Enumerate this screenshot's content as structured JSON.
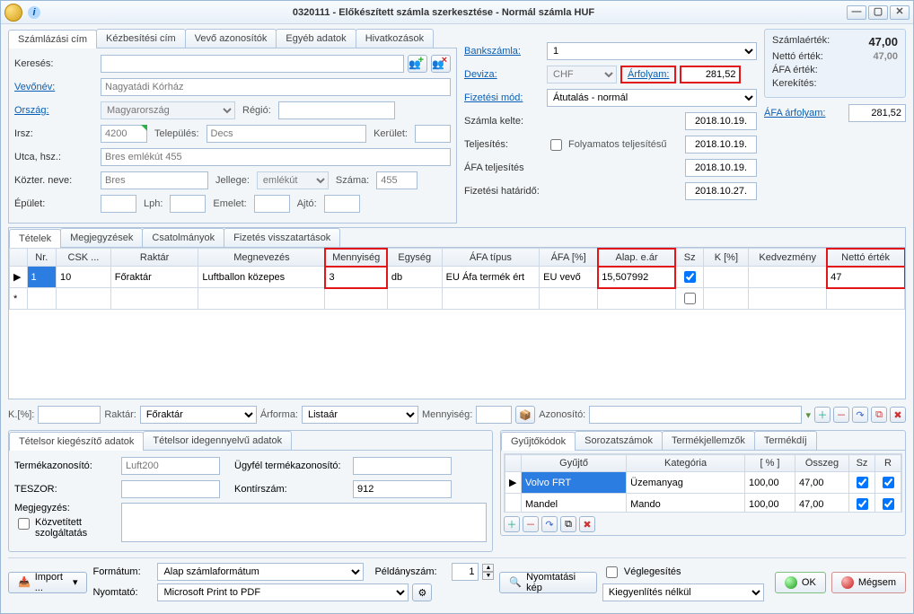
{
  "window": {
    "title": "0320111 - Előkészített számla szerkesztése - Normál számla HUF"
  },
  "addr_tabs": [
    "Számlázási cím",
    "Kézbesítési cím",
    "Vevő azonosítók",
    "Egyéb adatok",
    "Hivatkozások"
  ],
  "addr": {
    "search_lbl": "Keresés:",
    "vevonev_lbl": "Vevőnév:",
    "vevonev": "Nagyatádi Kórház",
    "orszag_lbl": "Ország:",
    "orszag": "Magyarország",
    "regio_lbl": "Régió:",
    "irsz_lbl": "Irsz:",
    "irsz": "4200",
    "telepules_lbl": "Település:",
    "telepules": "Decs",
    "kerulet_lbl": "Kerület:",
    "utca_lbl": "Utca, hsz.:",
    "utca": "Bres emlékút 455",
    "kozter_lbl": "Közter. neve:",
    "kozter": "Bres",
    "jellege_lbl": "Jellege:",
    "jellege": "emlékút",
    "szama_lbl": "Száma:",
    "szama": "455",
    "epulet_lbl": "Épület:",
    "lph_lbl": "Lph:",
    "emelet_lbl": "Emelet:",
    "ajto_lbl": "Ajtó:"
  },
  "mid": {
    "bankszamla_lbl": "Bankszámla:",
    "bankszamla": "1",
    "deviza_lbl": "Deviza:",
    "deviza": "CHF",
    "arfolyam_lbl": "Árfolyam:",
    "arfolyam": "281,52",
    "fizmod_lbl": "Fizetési mód:",
    "fizmod": "Átutalás - normál",
    "kelte_lbl": "Számla kelte:",
    "kelte": "2018.10.19.",
    "teljesites_lbl": "Teljesítés:",
    "folyamatos_lbl": "Folyamatos teljesítésű",
    "teljesites": "2018.10.19.",
    "afatelj_lbl": "ÁFA teljesítés",
    "afatelj": "2018.10.19.",
    "fizhat_lbl": "Fizetési határidő:",
    "fizhat": "2018.10.27."
  },
  "sums": {
    "szamlaertek_lbl": "Számlaérték:",
    "szamlaertek": "47,00",
    "netto_lbl": "Nettó érték:",
    "netto": "47,00",
    "afa_lbl": "ÁFA érték:",
    "kerekites_lbl": "Kerekítés:",
    "afa_arfolyam_lbl": "ÁFA árfolyam:",
    "afa_arfolyam": "281,52"
  },
  "items_tabs": [
    "Tételek",
    "Megjegyzések",
    "Csatolmányok",
    "Fizetés visszatartások"
  ],
  "items_cols": [
    "Nr.",
    "CSK ...",
    "Raktár",
    "Megnevezés",
    "Mennyiség",
    "Egység",
    "ÁFA típus",
    "ÁFA [%]",
    "Alap. e.ár",
    "Sz",
    "K [%]",
    "Kedvezmény",
    "Nettó érték"
  ],
  "items_rows": [
    {
      "nr": "1",
      "csk": "10",
      "raktar": "Főraktár",
      "megn": "Luftballon közepes",
      "menny": "3",
      "egys": "db",
      "afat": "EU Áfa termék ért",
      "afap": "EU vevő",
      "alap": "15,507992",
      "sz": true,
      "kpct": "",
      "kedv": "",
      "netto": "47"
    }
  ],
  "filter": {
    "kpct_lbl": "K.[%]:",
    "raktar_lbl": "Raktár:",
    "raktar": "Főraktár",
    "arforma_lbl": "Árforma:",
    "arforma": "Listaár",
    "mennyiseg_lbl": "Mennyiség:",
    "azonosito_lbl": "Azonosító:"
  },
  "detail_tabs_left": [
    "Tételsor kiegészítő adatok",
    "Tételsor idegennyelvű adatok"
  ],
  "detail_left": {
    "termekazon_lbl": "Termékazonosító:",
    "termekazon": "Luft200",
    "ugyfelterm_lbl": "Ügyfél termékazonosító:",
    "teszor_lbl": "TESZOR:",
    "kontir_lbl": "Kontírszám:",
    "kontir": "912",
    "megjegyzes_lbl": "Megjegyzés:",
    "kozvetitett_lbl": "Közvetített szolgáltatás"
  },
  "detail_tabs_right": [
    "Gyűjtőkódok",
    "Sorozatszámok",
    "Termékjellemzők",
    "Termékdíj"
  ],
  "gyujto_cols": [
    "Gyűjtő",
    "Kategória",
    "[ % ]",
    "Összeg",
    "Sz",
    "R"
  ],
  "gyujto_rows": [
    {
      "gy": "Volvo FRT",
      "kat": "Üzemanyag",
      "pct": "100,00",
      "ossz": "47,00",
      "sz": true,
      "r": true
    },
    {
      "gy": "Mandel",
      "kat": "Mando",
      "pct": "100,00",
      "ossz": "47,00",
      "sz": true,
      "r": true
    }
  ],
  "footer": {
    "import": "Import ...",
    "formatum_lbl": "Formátum:",
    "formatum": "Alap számlaformátum",
    "peldany_lbl": "Példányszám:",
    "peldany": "1",
    "nyomtato_lbl": "Nyomtató:",
    "nyomtato": "Microsoft Print to PDF",
    "nyomtkep": "Nyomtatási kép",
    "veglegesites": "Véglegesítés",
    "kiegyenlites": "Kiegyenlítés nélkül",
    "ok": "OK",
    "megsem": "Mégsem"
  }
}
